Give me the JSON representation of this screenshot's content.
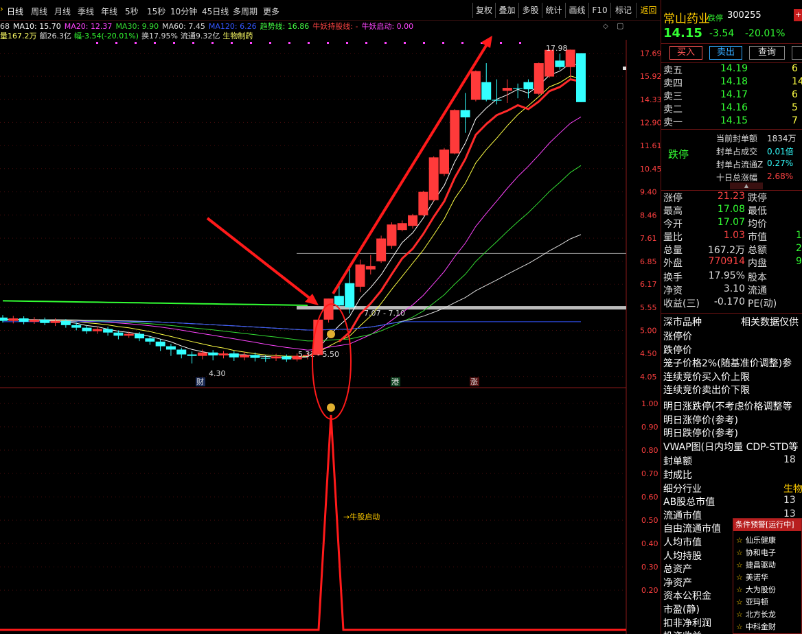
{
  "periods": [
    "日线",
    "周线",
    "月线",
    "季线",
    "年线",
    "5秒",
    "15秒",
    "10分钟",
    "45日线",
    "多周期",
    "更多"
  ],
  "toolbar": [
    "复权",
    "叠加",
    "多股",
    "统计",
    "画线",
    "F10",
    "标记"
  ],
  "back": "返回",
  "ma_legend": [
    {
      "text": "68",
      "color": "#dddddd"
    },
    {
      "text": "MA10: 15.70",
      "color": "#ffffff"
    },
    {
      "text": "MA20: 12.37",
      "color": "#ff44ff"
    },
    {
      "text": "MA30: 9.90",
      "color": "#33dd33"
    },
    {
      "text": "MA60: 7.45",
      "color": "#dddddd"
    },
    {
      "text": "MA120: 6.26",
      "color": "#3355ff"
    },
    {
      "text": "趋势线: 16.86",
      "color": "#44ff44"
    },
    {
      "text": "牛妖持股线: -",
      "color": "#ff4444"
    },
    {
      "text": "牛妖启动: 0.00",
      "color": "#ff44ff"
    }
  ],
  "vol_line": [
    {
      "text": "量167.2万",
      "color": "#ffff66"
    },
    {
      "text": "额26.3亿",
      "color": "#dddddd"
    },
    {
      "text": "幅-3.54(-20.01%)",
      "color": "#33ff33"
    },
    {
      "text": "换17.95%",
      "color": "#dddddd"
    },
    {
      "text": "流通9.32亿",
      "color": "#dddddd"
    },
    {
      "text": "生物制药",
      "color": "#ffff66"
    }
  ],
  "chart_data": [
    {
      "type": "candlestick",
      "y_ticks": [
        "17.69",
        "15.92",
        "14.33",
        "12.90",
        "11.61",
        "10.45",
        "9.40",
        "8.46",
        "7.61",
        "6.85",
        "6.17",
        "5.55",
        "5.00",
        "4.50",
        "4.05"
      ],
      "candles": [
        {
          "o": 5.3,
          "c": 5.22,
          "h": 5.36,
          "l": 5.18
        },
        {
          "o": 5.22,
          "c": 5.28,
          "h": 5.34,
          "l": 5.16
        },
        {
          "o": 5.28,
          "c": 5.2,
          "h": 5.33,
          "l": 5.14
        },
        {
          "o": 5.2,
          "c": 5.25,
          "h": 5.31,
          "l": 5.15
        },
        {
          "o": 5.25,
          "c": 5.17,
          "h": 5.3,
          "l": 5.12
        },
        {
          "o": 5.17,
          "c": 5.22,
          "h": 5.28,
          "l": 5.1
        },
        {
          "o": 5.22,
          "c": 5.12,
          "h": 5.26,
          "l": 5.06
        },
        {
          "o": 5.12,
          "c": 5.06,
          "h": 5.18,
          "l": 5.0
        },
        {
          "o": 5.06,
          "c": 4.98,
          "h": 5.12,
          "l": 4.92
        },
        {
          "o": 4.98,
          "c": 5.03,
          "h": 5.09,
          "l": 4.92
        },
        {
          "o": 5.03,
          "c": 4.95,
          "h": 5.08,
          "l": 4.88
        },
        {
          "o": 4.95,
          "c": 4.88,
          "h": 5.0,
          "l": 4.8
        },
        {
          "o": 4.88,
          "c": 4.92,
          "h": 4.97,
          "l": 4.83
        },
        {
          "o": 4.92,
          "c": 4.82,
          "h": 4.96,
          "l": 4.76
        },
        {
          "o": 4.82,
          "c": 4.75,
          "h": 4.88,
          "l": 4.68
        },
        {
          "o": 4.75,
          "c": 4.65,
          "h": 4.8,
          "l": 4.55
        },
        {
          "o": 4.65,
          "c": 4.58,
          "h": 4.7,
          "l": 4.45
        },
        {
          "o": 4.58,
          "c": 4.48,
          "h": 4.62,
          "l": 4.4
        },
        {
          "o": 4.48,
          "c": 4.45,
          "h": 4.54,
          "l": 4.3
        },
        {
          "o": 4.45,
          "c": 4.52,
          "h": 4.58,
          "l": 4.38
        },
        {
          "o": 4.52,
          "c": 4.46,
          "h": 4.57,
          "l": 4.36
        },
        {
          "o": 4.46,
          "c": 4.5,
          "h": 4.55,
          "l": 4.4
        },
        {
          "o": 4.5,
          "c": 4.42,
          "h": 4.55,
          "l": 4.35
        },
        {
          "o": 4.42,
          "c": 4.47,
          "h": 4.53,
          "l": 4.36
        },
        {
          "o": 4.47,
          "c": 4.41,
          "h": 4.52,
          "l": 4.34
        },
        {
          "o": 4.41,
          "c": 4.4,
          "h": 4.46,
          "l": 4.33
        },
        {
          "o": 4.4,
          "c": 4.44,
          "h": 4.49,
          "l": 4.35
        },
        {
          "o": 4.44,
          "c": 4.38,
          "h": 4.48,
          "l": 4.33
        },
        {
          "o": 4.38,
          "c": 4.45,
          "h": 4.5,
          "l": 4.34
        },
        {
          "o": 4.45,
          "c": 4.47,
          "h": 4.52,
          "l": 4.38
        },
        {
          "o": 4.47,
          "c": 5.25,
          "h": 5.25,
          "l": 4.45
        },
        {
          "o": 5.25,
          "c": 5.78,
          "h": 5.78,
          "l": 5.18
        },
        {
          "o": 5.85,
          "c": 5.6,
          "h": 6.2,
          "l": 5.5
        },
        {
          "o": 6.2,
          "c": 5.55,
          "h": 6.75,
          "l": 5.4
        },
        {
          "o": 6.1,
          "c": 6.75,
          "h": 6.9,
          "l": 5.95
        },
        {
          "o": 6.6,
          "c": 6.7,
          "h": 7.05,
          "l": 6.45
        },
        {
          "o": 6.85,
          "c": 7.6,
          "h": 7.7,
          "l": 6.8
        },
        {
          "o": 7.35,
          "c": 8.1,
          "h": 8.18,
          "l": 7.25
        },
        {
          "o": 7.9,
          "c": 8.15,
          "h": 8.25,
          "l": 7.85
        },
        {
          "o": 8.05,
          "c": 8.45,
          "h": 8.5,
          "l": 7.95
        },
        {
          "o": 8.45,
          "c": 9.4,
          "h": 9.45,
          "l": 8.42
        },
        {
          "o": 9.05,
          "c": 11.0,
          "h": 11.05,
          "l": 9.0
        },
        {
          "o": 10.2,
          "c": 11.4,
          "h": 11.48,
          "l": 10.1
        },
        {
          "o": 11.2,
          "c": 13.65,
          "h": 13.7,
          "l": 11.15
        },
        {
          "o": 13.65,
          "c": 13.2,
          "h": 14.75,
          "l": 12.3
        },
        {
          "o": 14.3,
          "c": 16.3,
          "h": 16.35,
          "l": 14.2
        },
        {
          "o": 15.5,
          "c": 14.3,
          "h": 16.9,
          "l": 14.2
        },
        {
          "o": 14.3,
          "c": 14.25,
          "h": 15.7,
          "l": 14.0
        },
        {
          "o": 14.9,
          "c": 15.1,
          "h": 15.7,
          "l": 14.1
        },
        {
          "o": 15.1,
          "c": 15.05,
          "h": 15.4,
          "l": 14.4
        },
        {
          "o": 15.5,
          "c": 15.0,
          "h": 15.7,
          "l": 14.4
        },
        {
          "o": 14.7,
          "c": 16.9,
          "h": 16.95,
          "l": 14.6
        },
        {
          "o": 15.9,
          "c": 17.95,
          "h": 17.98,
          "l": 15.8
        },
        {
          "o": 17.1,
          "c": 16.6,
          "h": 17.65,
          "l": 16.4
        },
        {
          "o": 16.6,
          "c": 17.97,
          "h": 17.98,
          "l": 15.8
        },
        {
          "o": 17.69,
          "c": 14.15,
          "h": 17.69,
          "l": 14.15
        }
      ],
      "annotations": [
        "17.98",
        "4.30",
        "7.07 - 7.10",
        "5.31 - 5.50"
      ],
      "tags": [
        "财",
        "港",
        "涨"
      ]
    },
    {
      "type": "line",
      "y_ticks": [
        "1.00",
        "0.90",
        "0.80",
        "0.70",
        "0.60",
        "0.50",
        "0.40",
        "0.30",
        "0.20"
      ],
      "annotation": "→牛股启动"
    }
  ],
  "quote": {
    "name": "常山药业",
    "limit_badge": "跌停",
    "code": "300255",
    "price": "14.15",
    "change": "-3.54",
    "pct": "-20.01%",
    "buttons": [
      "买入",
      "卖出",
      "查询"
    ],
    "sell_rows": [
      {
        "label": "卖五",
        "price": "14.19",
        "vol": "6"
      },
      {
        "label": "卖四",
        "price": "14.18",
        "vol": "14"
      },
      {
        "label": "卖三",
        "price": "14.17",
        "vol": "6"
      },
      {
        "label": "卖二",
        "price": "14.16",
        "vol": "5"
      },
      {
        "label": "卖一",
        "price": "14.15",
        "vol": "7"
      }
    ],
    "seal_label": "跌停",
    "seal": [
      {
        "k": "当前封单额",
        "v": "1834万",
        "vc": "#dddddd"
      },
      {
        "k": "封单占成交",
        "v": "0.01倍",
        "vc": "#33ffff"
      },
      {
        "k": "封单占流通Z",
        "v": "0.27%",
        "vc": "#33ffff"
      },
      {
        "k": "十日总涨幅",
        "v": "2.68%",
        "vc": "#ff4444"
      }
    ],
    "stats": [
      {
        "k": "涨停",
        "v": "21.23",
        "vc": "#ff4444",
        "k2": "跌停",
        "v2": ""
      },
      {
        "k": "最高",
        "v": "17.08",
        "vc": "#33ff33",
        "k2": "最低",
        "v2": ""
      },
      {
        "k": "今开",
        "v": "17.07",
        "vc": "#33ff33",
        "k2": "均价",
        "v2": ""
      },
      {
        "k": "量比",
        "v": "1.03",
        "vc": "#ff4444",
        "k2": "市值",
        "v2": "1"
      },
      {
        "k": "总量",
        "v": "167.2万",
        "vc": "#dddddd",
        "k2": "总额",
        "v2": "2"
      },
      {
        "k": "外盘",
        "v": "770914",
        "vc": "#ff4444",
        "k2": "内盘",
        "v2": "9"
      },
      {
        "k": "换手",
        "v": "17.95%",
        "vc": "#dddddd",
        "k2": "股本",
        "v2": ""
      },
      {
        "k": "净资",
        "v": "3.10",
        "vc": "#dddddd",
        "k2": "流通",
        "v2": ""
      },
      {
        "k": "收益(三)",
        "v": "-0.170",
        "vc": "#dddddd",
        "k2": "PE(动)",
        "v2": ""
      }
    ],
    "tabs": [
      "深市品种",
      "相关数据仅供"
    ],
    "info_rows": [
      "涨停价",
      "跌停价",
      "笼子价格2%(随基准价调整)参",
      "连续竞价买入价上限",
      "连续竞价卖出价下限",
      "明日涨跌停(不考虑价格调整等",
      "明日涨停价(参考)",
      "明日跌停价(参考)",
      "VWAP图(日内均量 CDP-STD等",
      "封单额",
      "封成比",
      "细分行业",
      "AB股总市值",
      "流通市值",
      "自由流通市值",
      "人均市值",
      "人均持股",
      "总资产",
      "净资产",
      "资本公积金",
      "市盈(静)",
      "扣非净利润",
      "投资收益"
    ],
    "info_vals": {
      "封单额": "18",
      "细分行业": "生物",
      "AB股总市值": "13",
      "流通市值": "13"
    }
  },
  "alerts": {
    "title": "条件预警[运行中]",
    "items": [
      "仙乐健康",
      "协和电子",
      "捷昌驱动",
      "美诺华",
      "大为股份",
      "亚玛顿",
      "北方长龙",
      "中科金财"
    ]
  },
  "colors": {
    "up": "#ff3a3a",
    "down": "#33ffff",
    "grid": "#4a0d0d",
    "axis": "#8b1a1a"
  }
}
